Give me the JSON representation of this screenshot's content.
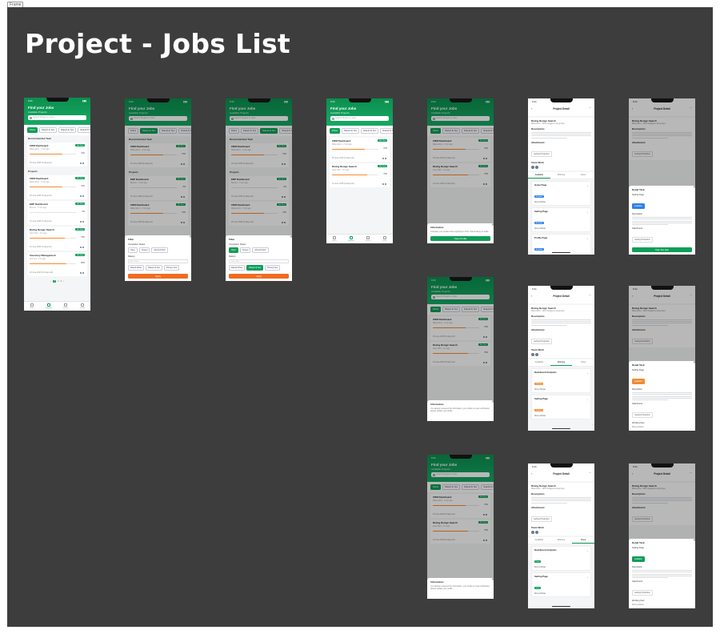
{
  "frame_tag": "Frame",
  "page_title": "Project - Jobs List",
  "status": {
    "time": "9:41",
    "signal": "▮▮▮"
  },
  "list": {
    "title": "Find your Jobs",
    "subtitle": "Available Projects",
    "search_placeholder": "Search Project or Jobs",
    "chips": [
      "Filters",
      "Rate(0-2) Sec",
      "Rate(2-4) Sec",
      "Rate(4-6) Sec"
    ],
    "recommended": "Recommended Task",
    "projects_label": "Projects",
    "cards": [
      {
        "title": "CRM Dashboard",
        "sub": "Rikke Elmo · 2 min ago",
        "tag": "Not Start",
        "pct": "70%",
        "progress": 0.7,
        "due": "25 June 2025 (8 days left)"
      },
      {
        "title": "ERP Dashboard",
        "sub": "Benson · 5 min ago",
        "tag": "Not Start",
        "pct": "0%",
        "progress": 0,
        "due": "15 June 2025 (3 days left)"
      },
      {
        "title": "Diving Design Search",
        "sub": "Liam Hart · 1 hr ago",
        "tag": "Not Start",
        "pct": "75%",
        "progress": 0.75,
        "due": "19 June 2025 (8 days left)"
      },
      {
        "title": "Inventory Management",
        "sub": "Ana Lee · 3 hr ago",
        "tag": "Not Start",
        "pct": "80%",
        "progress": 0.8,
        "due": "22 June 2025 (10 days left)"
      }
    ],
    "pages": [
      "‹",
      "1",
      "2",
      "3",
      "›"
    ],
    "tabs": [
      "Home",
      "Projects",
      "Search",
      "Profile"
    ]
  },
  "filter": {
    "title": "Filter",
    "completion": "Completion Status",
    "options": [
      "Open",
      "Closed",
      "Almost Finish"
    ],
    "rate_label": "Rate(s)",
    "rate_placeholder": "Enter Rate",
    "rate_options": [
      "Rate(0-2)Sec",
      "Rate(2-4) Sec",
      "Price(s) Sec"
    ],
    "apply": "Apply"
  },
  "info": {
    "title": "Information",
    "text": "Complete your profile before applying to Jobs. Start looking on tasks.",
    "button": "Open Profile",
    "text_alt": "You already reviewed the information, your profile is under verification, please update your profile."
  },
  "detail": {
    "title": "Project Detail",
    "project": "Diving Design Search",
    "meta": "Rikke Elmo · 2022 Singapore along days",
    "description": "Description",
    "attachment": "Attachment",
    "attach_file": "Getting Production",
    "team": "Team Work",
    "tabs": [
      "Available",
      "Working",
      "Done"
    ],
    "tasks": [
      {
        "title": "Home Page",
        "badge": "Available",
        "who": "Ronny Rohan"
      },
      {
        "title": "Setting Page",
        "badge": "Available",
        "who": "Ronny Rohan"
      },
      {
        "title": "Profile Page",
        "badge": "Available",
        "who": "Ronny Rohan"
      }
    ],
    "working_tasks": [
      {
        "title": "Dashboard Analytics",
        "badge": "Working",
        "who": "Ronny Rohan"
      },
      {
        "title": "Setting Page",
        "badge": "Working",
        "who": "Ronny Rohan"
      }
    ],
    "done_tasks": [
      {
        "title": "Dashboard Analytics",
        "badge": "Done",
        "who": "Ronny Rohan"
      },
      {
        "title": "Setting Page",
        "badge": "Done",
        "who": "Ronny Rohan"
      }
    ],
    "detail_task": "Detail Task",
    "task_name": "Setting Page",
    "working_user": "Working User",
    "take_btn": "Take this task"
  },
  "colors": {
    "brand": "#0f9d58",
    "accent": "#f26b21",
    "canvas": "#3d3d3d",
    "available": "#2f80ed",
    "working": "#f28b32",
    "done": "#0f9d58"
  }
}
